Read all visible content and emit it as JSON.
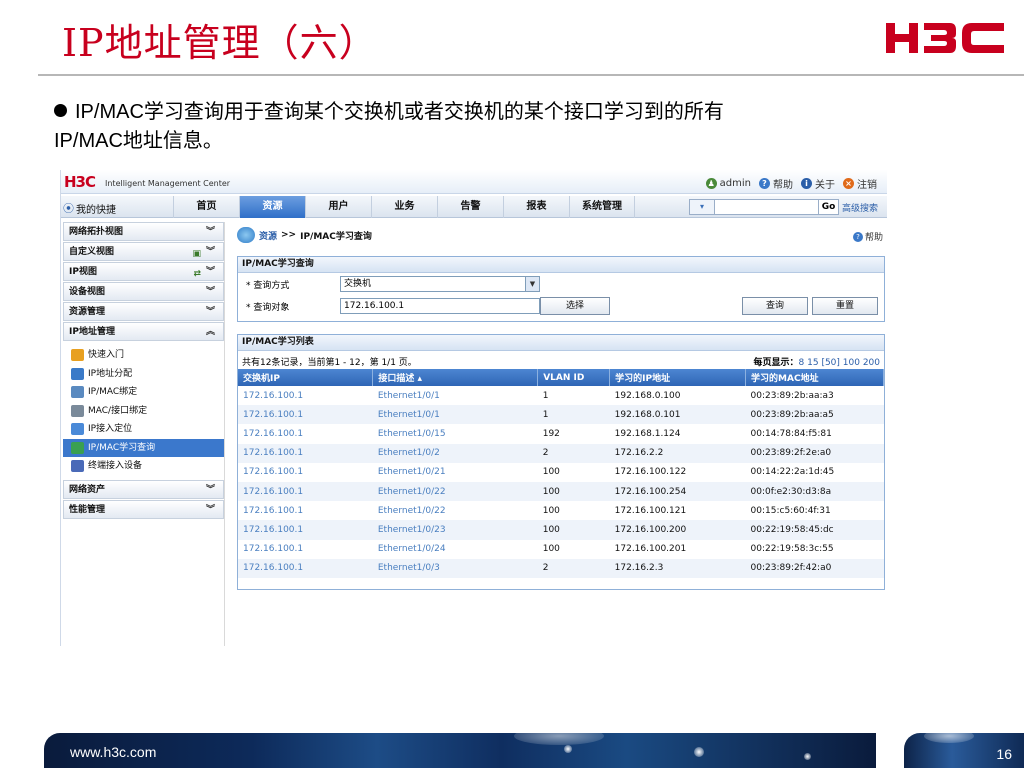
{
  "slide": {
    "title": "IP地址管理（六）",
    "bullet_line1": "IP/MAC学习查询用于查询某个交换机或者交换机的某个接口学习到的所有",
    "bullet_line2": "IP/MAC地址信息。",
    "brand_color": "#c8001e",
    "footer_url": "www.h3c.com",
    "page_number": "16"
  },
  "app": {
    "logo": "H3C",
    "logo_sub": "Intelligent Management Center",
    "topbar": {
      "user": "admin",
      "help": "帮助",
      "about": "关于",
      "logout": "注销"
    },
    "shortcut": "我的快捷",
    "tabs": [
      "首页",
      "资源",
      "用户",
      "业务",
      "告警",
      "报表",
      "系统管理"
    ],
    "active_tab": "资源",
    "search": {
      "go": "Go",
      "advanced": "高级搜索"
    },
    "sidebar": {
      "top_groups": [
        "网络拓扑视图",
        "自定义视图",
        "IP视图",
        "设备视图",
        "资源管理",
        "IP地址管理"
      ],
      "items": [
        "快速入门",
        "IP地址分配",
        "IP/MAC绑定",
        "MAC/接口绑定",
        "IP接入定位",
        "IP/MAC学习查询",
        "终端接入设备"
      ],
      "active_item": "IP/MAC学习查询",
      "bottom_groups": [
        "网络资产",
        "性能管理"
      ]
    },
    "breadcrumb": {
      "root": "资源",
      "sep": ">>",
      "current": "IP/MAC学习查询"
    },
    "help_link": "帮助",
    "query": {
      "title": "IP/MAC学习查询",
      "mode_label": "* 查询方式",
      "mode_value": "交换机",
      "target_label": "* 查询对象",
      "target_value": "172.16.100.1",
      "select_btn": "选择",
      "query_btn": "查询",
      "reset_btn": "重置"
    },
    "list": {
      "title": "IP/MAC学习列表",
      "summary": "共有12条记录，当前第1 - 12，第 1/1 页。",
      "page_size_label": "每页显示：",
      "page_sizes": "8 15 [50] 100 200",
      "columns": [
        "交换机IP",
        "接口描述 ▴",
        "VLAN ID",
        "学习的IP地址",
        "学习的MAC地址"
      ],
      "rows": [
        [
          "172.16.100.1",
          "Ethernet1/0/1",
          "1",
          "192.168.0.100",
          "00:23:89:2b:aa:a3"
        ],
        [
          "172.16.100.1",
          "Ethernet1/0/1",
          "1",
          "192.168.0.101",
          "00:23:89:2b:aa:a5"
        ],
        [
          "172.16.100.1",
          "Ethernet1/0/15",
          "192",
          "192.168.1.124",
          "00:14:78:84:f5:81"
        ],
        [
          "172.16.100.1",
          "Ethernet1/0/2",
          "2",
          "172.16.2.2",
          "00:23:89:2f:2e:a0"
        ],
        [
          "172.16.100.1",
          "Ethernet1/0/21",
          "100",
          "172.16.100.122",
          "00:14:22:2a:1d:45"
        ],
        [
          "172.16.100.1",
          "Ethernet1/0/22",
          "100",
          "172.16.100.254",
          "00:0f:e2:30:d3:8a"
        ],
        [
          "172.16.100.1",
          "Ethernet1/0/22",
          "100",
          "172.16.100.121",
          "00:15:c5:60:4f:31"
        ],
        [
          "172.16.100.1",
          "Ethernet1/0/23",
          "100",
          "172.16.100.200",
          "00:22:19:58:45:dc"
        ],
        [
          "172.16.100.1",
          "Ethernet1/0/24",
          "100",
          "172.16.100.201",
          "00:22:19:58:3c:55"
        ],
        [
          "172.16.100.1",
          "Ethernet1/0/3",
          "2",
          "172.16.2.3",
          "00:23:89:2f:42:a0"
        ]
      ]
    }
  }
}
